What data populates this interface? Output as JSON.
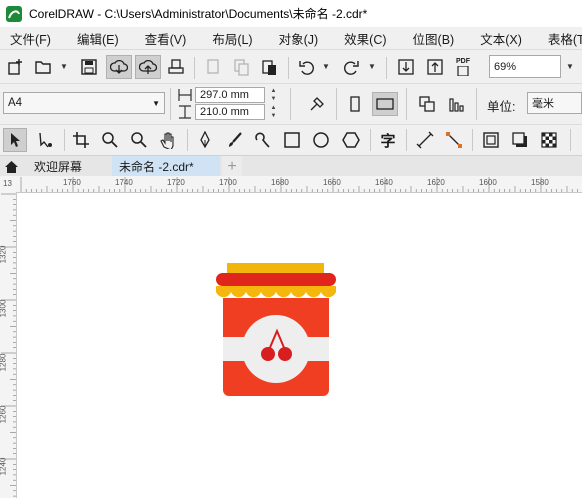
{
  "window": {
    "title": "CorelDRAW - C:\\Users\\Administrator\\Documents\\未命名 -2.cdr*"
  },
  "menu": [
    "文件(F)",
    "编辑(E)",
    "查看(V)",
    "布局(L)",
    "对象(J)",
    "效果(C)",
    "位图(B)",
    "文本(X)",
    "表格(T)"
  ],
  "toolbar": {
    "zoom_value": "69%",
    "pdf_label": "PDF"
  },
  "property_bar": {
    "page_size": "A4",
    "width": "297.0 mm",
    "height": "210.0 mm",
    "units_label": "单位:",
    "units_value": "毫米"
  },
  "toolbox": {
    "text_tool_glyph": "字"
  },
  "tabs": {
    "welcome": "欢迎屏幕",
    "document": "未命名 -2.cdr*",
    "add": "+"
  },
  "ruler": {
    "top": [
      "1760",
      "1740",
      "1720",
      "1700",
      "1680",
      "1660",
      "1640",
      "1620",
      "1600",
      "1580"
    ],
    "left": [
      "1320",
      "1300",
      "1280",
      "1260",
      "1240"
    ],
    "corner_top": "13"
  },
  "colors": {
    "jar_body": "#ef3e21",
    "jar_lid": "#e0261c",
    "lid_top": "#f2b50b",
    "scallop": "#f5b70e",
    "label_band": "#efeeee",
    "cherry": "#d81e1e"
  }
}
